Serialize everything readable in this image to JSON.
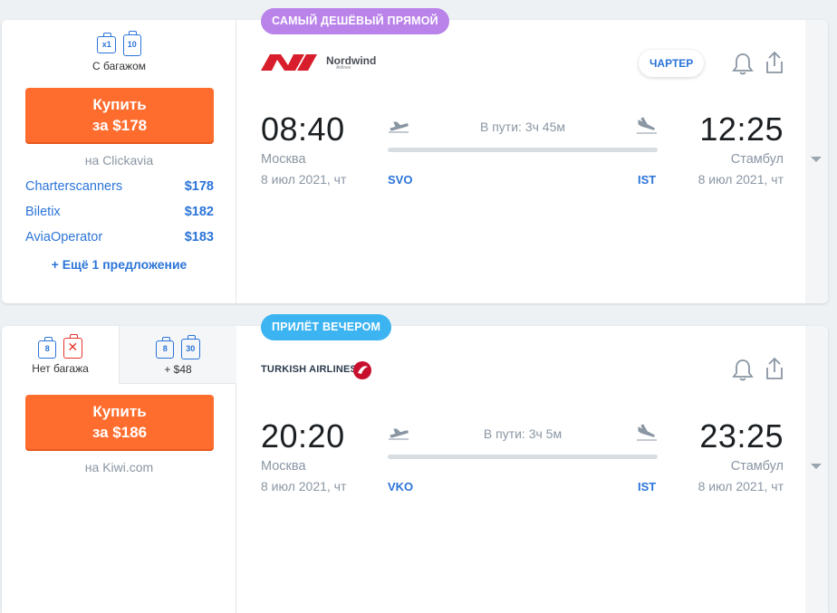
{
  "offers": [
    {
      "badge": "САМЫЙ ДЕШЁВЫЙ ПРЯМОЙ",
      "baggage": {
        "hand": "x1",
        "checked": "10",
        "caption": "С багажом"
      },
      "buy": {
        "line1": "Купить",
        "line2": "за $178"
      },
      "agency": "на Clickavia",
      "alternatives": [
        {
          "name": "Charterscanners",
          "price": "$178"
        },
        {
          "name": "Biletix",
          "price": "$182"
        },
        {
          "name": "AviaOperator",
          "price": "$183"
        }
      ],
      "more": "+ Ещё 1 предложение",
      "airline": {
        "name": "Nordwind",
        "sub": "Airlines",
        "color": "#d81e2c"
      },
      "charter": "ЧАРТЕР",
      "depart": {
        "time": "08:40",
        "city": "Москва",
        "date": "8 июл 2021, чт",
        "iata": "SVO"
      },
      "arrive": {
        "time": "12:25",
        "city": "Стамбул",
        "date": "8 июл 2021, чт",
        "iata": "IST"
      },
      "duration": "В пути: 3ч 45м"
    },
    {
      "badge": "ПРИЛЁТ ВЕЧЕРОМ",
      "tabs": [
        {
          "hand": "8",
          "caption": "Нет багажа"
        },
        {
          "hand": "8",
          "checked": "30",
          "caption": "+ $48"
        }
      ],
      "buy": {
        "line1": "Купить",
        "line2": "за $186"
      },
      "agency": "на Kiwi.com",
      "airline": {
        "name": "TURKISH AIRLINES",
        "color": "#c8102e"
      },
      "depart": {
        "time": "20:20",
        "city": "Москва",
        "date": "8 июл 2021, чт",
        "iata": "VKO"
      },
      "arrive": {
        "time": "23:25",
        "city": "Стамбул",
        "date": "8 июл 2021, чт",
        "iata": "IST"
      },
      "duration": "В пути: 3ч 5м"
    }
  ],
  "icons": {
    "bell": "bell-icon",
    "share": "share-icon",
    "takeoff": "takeoff-icon",
    "landing": "landing-icon",
    "expand": "chevron-down-icon"
  },
  "colors": {
    "accent": "#2b74d8",
    "buy": "#ff6d2e",
    "badge_cheap": "#b983e9",
    "badge_evening": "#3db4f2"
  }
}
